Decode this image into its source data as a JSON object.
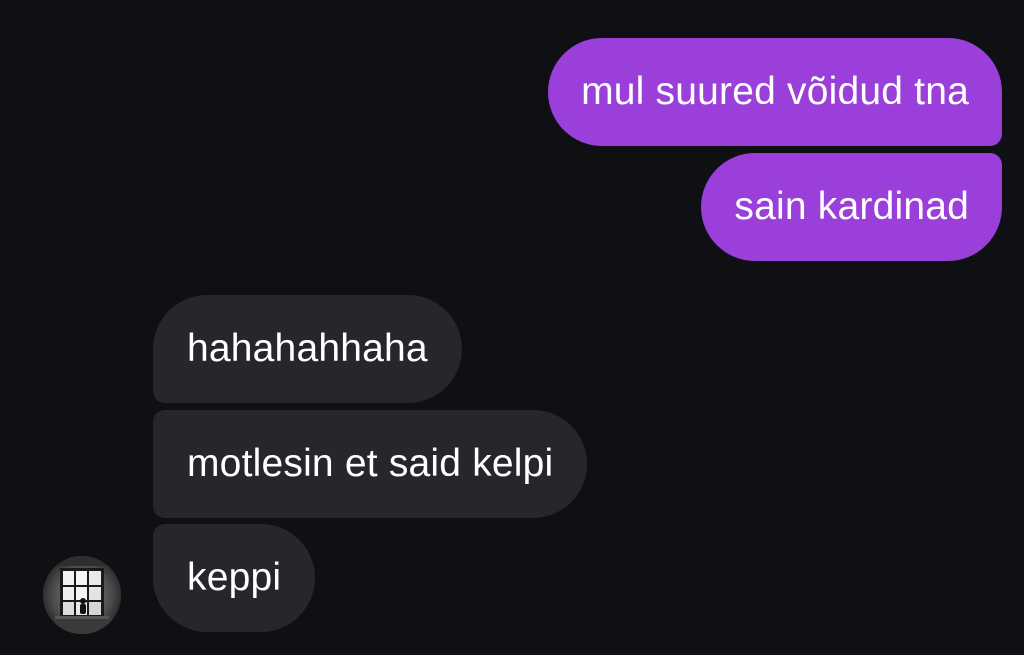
{
  "colors": {
    "background": "#0e1014",
    "outgoing_bubble": "#9b3fdb",
    "incoming_bubble": "#26272b",
    "text": "#ffffff"
  },
  "messages": {
    "outgoing": [
      {
        "text": "mul suured võidud tna"
      },
      {
        "text": "sain kardinad"
      }
    ],
    "incoming": [
      {
        "text": "hahahahhaha"
      },
      {
        "text": "motlesin et said kelpi"
      },
      {
        "text": "keppi"
      }
    ]
  },
  "contact": {
    "avatar_icon": "window-silhouette-photo-avatar"
  }
}
